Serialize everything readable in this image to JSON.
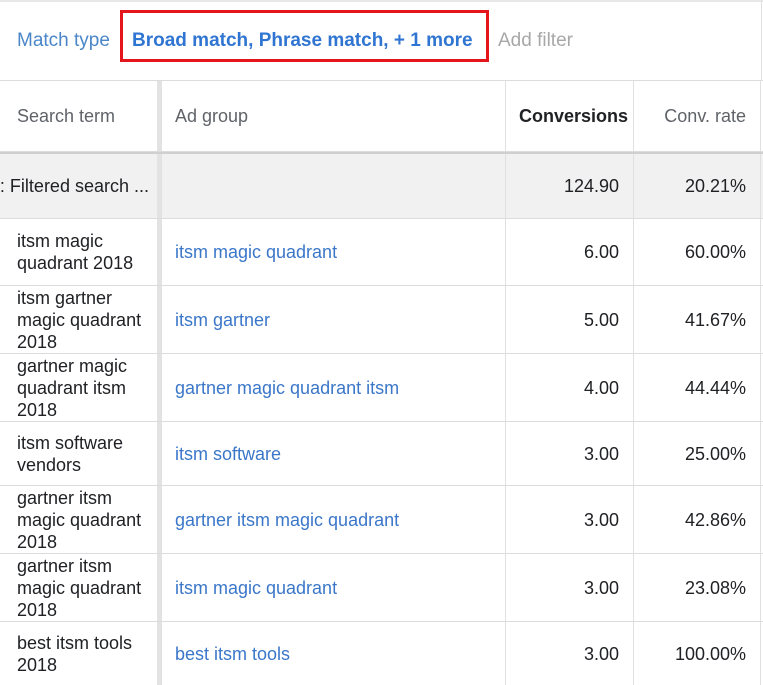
{
  "filter": {
    "label": "Match type",
    "chip": "Broad match, Phrase match, + 1 more",
    "add": "Add filter"
  },
  "table": {
    "headers": {
      "search_term": "Search term",
      "ad_group": "Ad group",
      "conversions": "Conversions",
      "conv_rate": "Conv. rate"
    },
    "total": {
      "label": "al: Filtered search ...",
      "conversions": "124.90",
      "conv_rate": "20.21%"
    },
    "rows": [
      {
        "term": "itsm magic quadrant 2018",
        "ad_group": "itsm magic quadrant",
        "conversions": "6.00",
        "conv_rate": "60.00%"
      },
      {
        "term": "itsm gartner magic quadrant 2018",
        "ad_group": "itsm gartner",
        "conversions": "5.00",
        "conv_rate": "41.67%"
      },
      {
        "term": "gartner magic quadrant itsm 2018",
        "ad_group": "gartner magic quadrant itsm",
        "conversions": "4.00",
        "conv_rate": "44.44%"
      },
      {
        "term": "itsm software vendors",
        "ad_group": "itsm software",
        "conversions": "3.00",
        "conv_rate": "25.00%"
      },
      {
        "term": "gartner itsm magic quadrant 2018",
        "ad_group": "gartner itsm magic quadrant",
        "conversions": "3.00",
        "conv_rate": "42.86%"
      },
      {
        "term": "gartner itsm magic quadrant 2018",
        "ad_group": "itsm magic quadrant",
        "conversions": "3.00",
        "conv_rate": "23.08%"
      },
      {
        "term": "best itsm tools 2018",
        "ad_group": "best itsm tools",
        "conversions": "3.00",
        "conv_rate": "100.00%"
      }
    ]
  },
  "colors": {
    "link": "#3b77c9",
    "chip_text": "#2f75d1",
    "chip_border": "#e5161b",
    "total_bg": "#f1f1f1"
  }
}
